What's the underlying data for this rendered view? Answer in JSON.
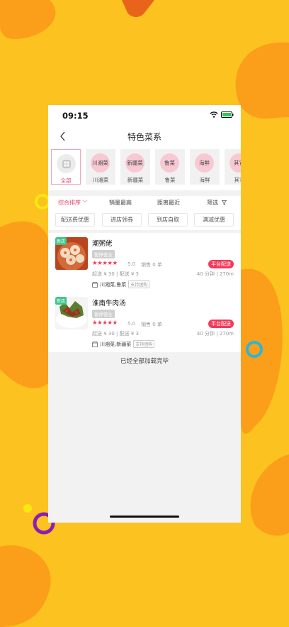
{
  "status_bar": {
    "time": "09:15"
  },
  "nav": {
    "title": "特色菜系"
  },
  "categories": [
    {
      "circle": "",
      "label": "全部",
      "active": true,
      "icon": "grid-icon"
    },
    {
      "circle": "川湘菜",
      "label": "川湘菜"
    },
    {
      "circle": "新疆菜",
      "label": "新疆菜"
    },
    {
      "circle": "鲁菜",
      "label": "鲁菜"
    },
    {
      "circle": "海鲜",
      "label": "海鲜"
    },
    {
      "circle": "其它",
      "label": "其它"
    }
  ],
  "sort": {
    "composite": "综合排序",
    "sales": "销量最高",
    "distance": "距离最近",
    "filter": "筛选"
  },
  "chips": [
    "配送费优惠",
    "进店领券",
    "到店自取",
    "满减优惠"
  ],
  "shops": [
    {
      "name": "潮粥佬",
      "new_tag": "新店",
      "status": "暂停营业",
      "stars": "★★★★★",
      "rating": "5.0",
      "sales": "销售 0 单",
      "delivery": "平台配送",
      "min_fee": "起送 ¥ 30 | 配送 ¥ 3",
      "time_distance": "40 分钟 | 270m",
      "cuisines": "川湘菜,鲁菜",
      "group_tag": "支持团购"
    },
    {
      "name": "淮南牛肉汤",
      "new_tag": "新店",
      "status": "暂停营业",
      "stars": "★★★★★",
      "rating": "5.0",
      "sales": "销售 0 单",
      "delivery": "平台配送",
      "min_fee": "起送 ¥ 30 | 配送 ¥ 3",
      "time_distance": "40 分钟 | 270m",
      "cuisines": "川湘菜,新疆菜",
      "group_tag": "支持团购"
    }
  ],
  "end_text": "已经全部加载完毕",
  "colors": {
    "accent": "#e8446a",
    "red_badge": "#f23a5a",
    "new_tag": "#3dc58c",
    "background_yellow": "#fcc21f",
    "background_orange": "#fb9e1a"
  }
}
